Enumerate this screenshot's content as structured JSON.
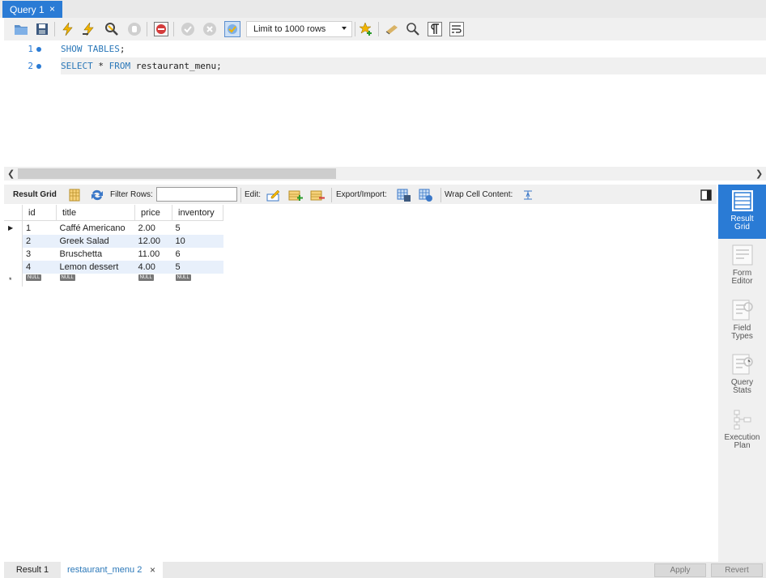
{
  "query_tab": {
    "label": "Query 1",
    "close": "×"
  },
  "toolbar": {
    "limit_value": "Limit to 1000 rows",
    "icons": [
      "open-folder-icon",
      "save-icon",
      "execute-icon",
      "execute-current-icon",
      "explain-icon",
      "stop-icon",
      "toggle-error-icon",
      "commit-icon",
      "rollback-icon",
      "autocommit-icon",
      "favorite-add-icon",
      "beautify-icon",
      "find-icon",
      "invisible-chars-icon",
      "wrap-icon"
    ]
  },
  "editor": {
    "lines": [
      {
        "num": "1",
        "parts": [
          {
            "t": "SHOW TABLES",
            "kw": true
          },
          {
            "t": ";",
            "kw": false
          }
        ]
      },
      {
        "num": "2",
        "parts": [
          {
            "t": "SELECT",
            "kw": true
          },
          {
            "t": " * ",
            "kw": false
          },
          {
            "t": "FROM",
            "kw": true
          },
          {
            "t": " restaurant_menu;",
            "kw": false
          }
        ]
      }
    ]
  },
  "result_toolbar": {
    "result_grid_label": "Result Grid",
    "filter_label": "Filter Rows:",
    "filter_value": "",
    "edit_label": "Edit:",
    "export_label": "Export/Import:",
    "wrap_label": "Wrap Cell Content:"
  },
  "grid": {
    "columns": [
      "id",
      "title",
      "price",
      "inventory"
    ],
    "rows": [
      [
        "1",
        "Caffé Americano",
        "2.00",
        "5"
      ],
      [
        "2",
        "Greek Salad",
        "12.00",
        "10"
      ],
      [
        "3",
        "Bruschetta",
        "11.00",
        "6"
      ],
      [
        "4",
        "Lemon dessert",
        "4.00",
        "5"
      ]
    ],
    "null_label": "NULL",
    "new_row_marker": "*",
    "current_row_marker": "▶"
  },
  "side_panel": [
    {
      "label": "Result\nGrid",
      "active": true,
      "icon": "result-grid-icon"
    },
    {
      "label": "Form\nEditor",
      "active": false,
      "icon": "form-editor-icon"
    },
    {
      "label": "Field\nTypes",
      "active": false,
      "icon": "field-types-icon"
    },
    {
      "label": "Query\nStats",
      "active": false,
      "icon": "query-stats-icon"
    },
    {
      "label": "Execution\nPlan",
      "active": false,
      "icon": "execution-plan-icon"
    }
  ],
  "bottom_tabs": {
    "tab1": "Result 1",
    "tab2": "restaurant_menu 2",
    "close": "×",
    "apply": "Apply",
    "revert": "Revert"
  },
  "colors": {
    "accent": "#2a7bd5",
    "keyword": "#2a77b8",
    "alt_row": "#e8f0fb"
  }
}
